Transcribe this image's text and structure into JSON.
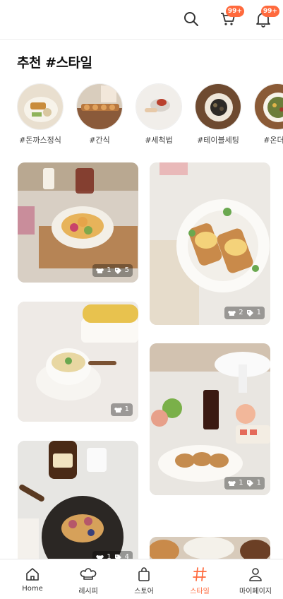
{
  "header": {
    "cart_badge": "99+",
    "notification_badge": "99+"
  },
  "section": {
    "title": "추천 #스타일"
  },
  "categories": [
    {
      "label": "#돈까스정식"
    },
    {
      "label": "#간식"
    },
    {
      "label": "#세척법"
    },
    {
      "label": "#테이블세팅"
    },
    {
      "label": "#온더테"
    }
  ],
  "posts": [
    {
      "recipes": "1",
      "products": "5"
    },
    {
      "recipes": "2",
      "products": "1"
    },
    {
      "recipes": "1",
      "products": ""
    },
    {
      "recipes": "1",
      "products": "1"
    },
    {
      "recipes": "1",
      "products": "4"
    }
  ],
  "tabs": [
    {
      "label": "Home"
    },
    {
      "label": "레시피"
    },
    {
      "label": "스토어"
    },
    {
      "label": "스타일"
    },
    {
      "label": "마이페이지"
    }
  ],
  "colors": {
    "accent": "#ff6a3d"
  }
}
